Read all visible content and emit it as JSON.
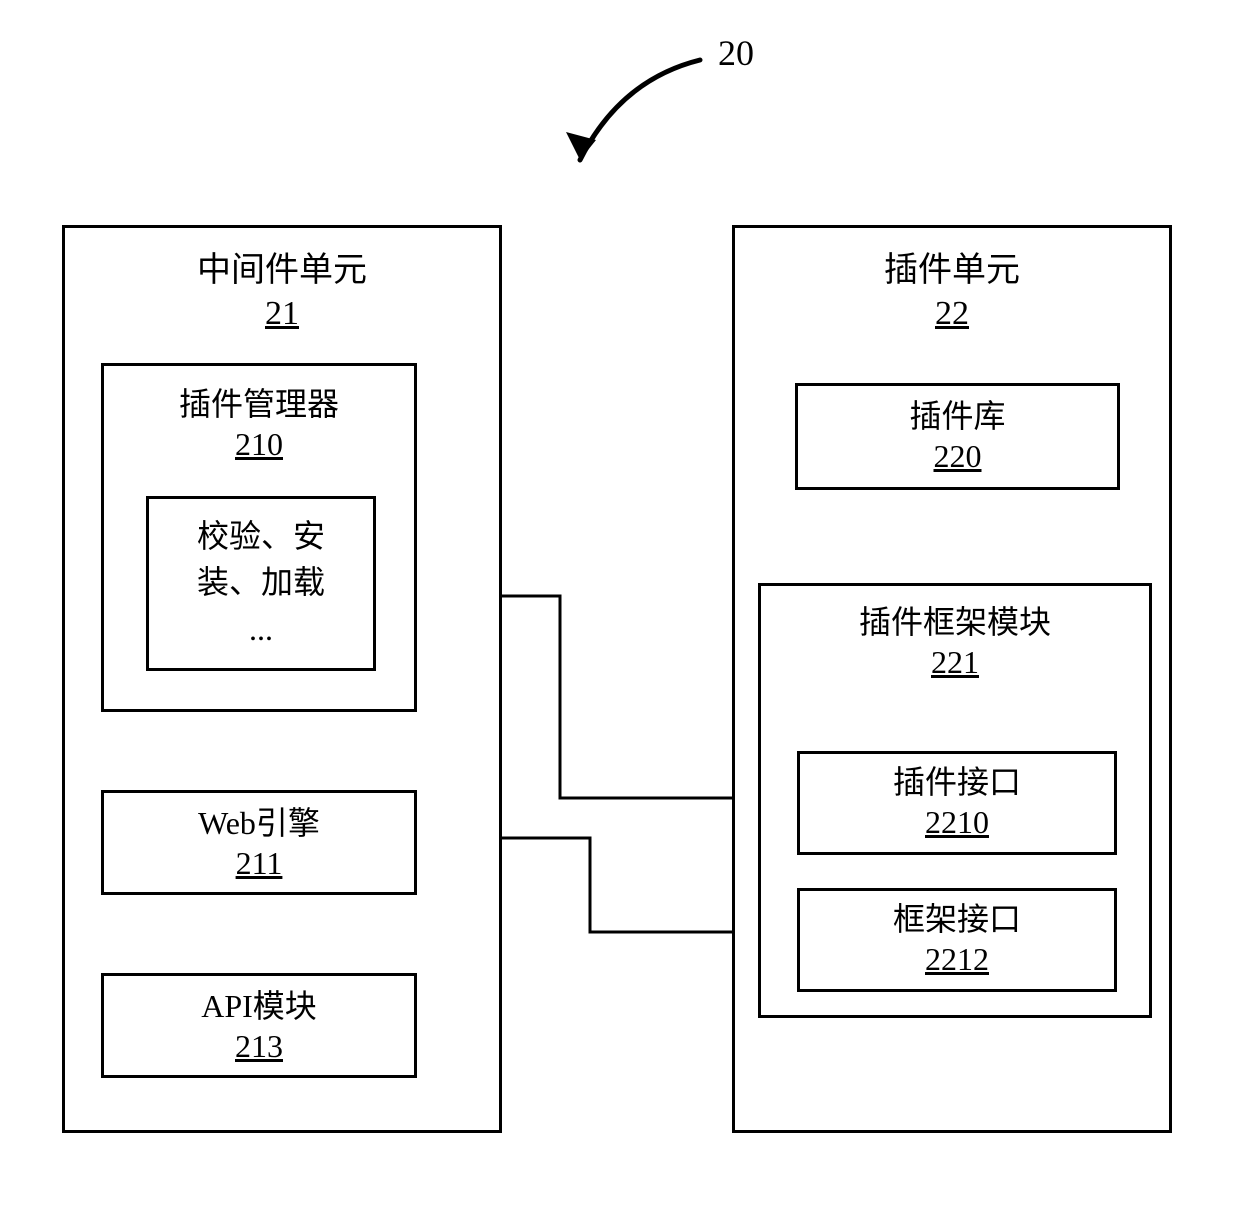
{
  "diagram": {
    "annotation": {
      "label": "20"
    },
    "left_unit": {
      "title": "中间件单元",
      "id": "21",
      "plugin_manager": {
        "title": "插件管理器",
        "id": "210",
        "ops": {
          "line1": "校验、安",
          "line2": "装、加载",
          "line3": "..."
        }
      },
      "web_engine": {
        "title": "Web引擎",
        "id": "211"
      },
      "api_module": {
        "title": "API模块",
        "id": "213"
      }
    },
    "right_unit": {
      "title": "插件单元",
      "id": "22",
      "plugin_lib": {
        "title": "插件库",
        "id": "220"
      },
      "plugin_framework": {
        "title": "插件框架模块",
        "id": "221",
        "plugin_interface": {
          "title": "插件接口",
          "id": "2210"
        },
        "frame_interface": {
          "title": "框架接口",
          "id": "2212"
        }
      }
    }
  }
}
